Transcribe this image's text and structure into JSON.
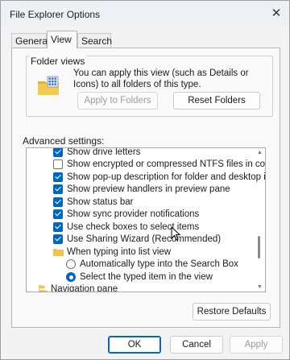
{
  "window": {
    "title": "File Explorer Options",
    "close_glyph": "✕"
  },
  "tabs": [
    {
      "label": "General"
    },
    {
      "label": "View",
      "selected": true
    },
    {
      "label": "Search"
    }
  ],
  "folder_views": {
    "legend": "Folder views",
    "description": "You can apply this view (such as Details or Icons) to all folders of this type.",
    "apply_label": "Apply to Folders",
    "reset_label": "Reset Folders",
    "icon": "folder-grid-icon"
  },
  "advanced": {
    "label": "Advanced settings:",
    "items": [
      {
        "type": "checkbox",
        "checked": true,
        "label": "Show drive letters"
      },
      {
        "type": "checkbox",
        "checked": false,
        "label": "Show encrypted or compressed NTFS files in colour"
      },
      {
        "type": "checkbox",
        "checked": true,
        "label": "Show pop-up description for folder and desktop items"
      },
      {
        "type": "checkbox",
        "checked": true,
        "label": "Show preview handlers in preview pane"
      },
      {
        "type": "checkbox",
        "checked": true,
        "label": "Show status bar"
      },
      {
        "type": "checkbox",
        "checked": true,
        "label": "Show sync provider notifications"
      },
      {
        "type": "checkbox",
        "checked": true,
        "label": "Use check boxes to select items"
      },
      {
        "type": "checkbox",
        "checked": true,
        "label": "Use Sharing Wizard (Recommended)"
      },
      {
        "type": "folder",
        "label": "When typing into list view"
      },
      {
        "type": "radio",
        "checked": false,
        "label": "Automatically type into the Search Box"
      },
      {
        "type": "radio",
        "checked": true,
        "label": "Select the typed item in the view"
      },
      {
        "type": "folder-root",
        "label": "Navigation pane"
      }
    ]
  },
  "restore_defaults_label": "Restore Defaults",
  "footer": {
    "ok": "OK",
    "cancel": "Cancel",
    "apply": "Apply"
  },
  "colors": {
    "accent": "#0067c0",
    "folder": "#f2c34c"
  }
}
